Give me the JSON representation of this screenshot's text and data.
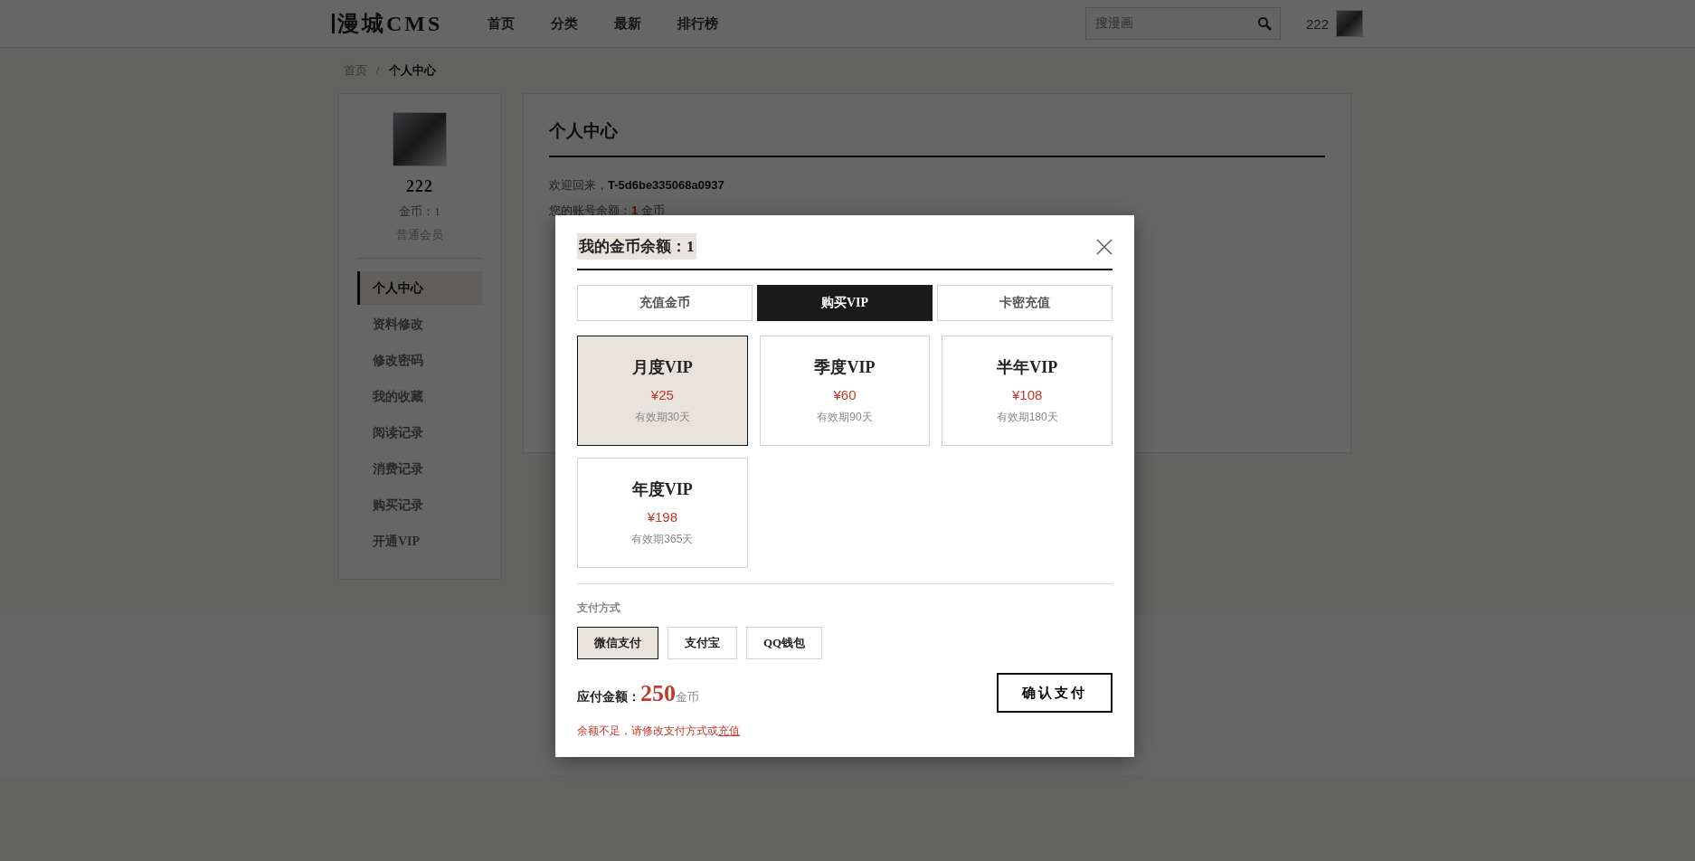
{
  "header": {
    "logo": "漫城CMS",
    "nav": [
      {
        "label": "首页"
      },
      {
        "label": "分类"
      },
      {
        "label": "最新"
      },
      {
        "label": "排行榜"
      }
    ],
    "search": {
      "placeholder": "搜漫画"
    },
    "username": "222"
  },
  "breadcrumb": [
    {
      "label": "首页",
      "selected": false
    },
    {
      "label": "个人中心",
      "selected": true
    }
  ],
  "breadcrumb_separator": "/",
  "sidebar": {
    "username": "222",
    "coins": "金币：1",
    "member_level": "普通会员",
    "items": [
      {
        "label": "个人中心",
        "selected": true
      },
      {
        "label": "资料修改",
        "selected": false
      },
      {
        "label": "修改密码",
        "selected": false
      },
      {
        "label": "我的收藏",
        "selected": false
      },
      {
        "label": "阅读记录",
        "selected": false
      },
      {
        "label": "消费记录",
        "selected": false
      },
      {
        "label": "购买记录",
        "selected": false
      },
      {
        "label": "开通VIP",
        "selected": false
      }
    ]
  },
  "content": {
    "title": "个人中心",
    "welcome": "欢迎回来，**T-5d6be335068a0937**",
    "balance_label": "您的账号余额：",
    "balance_value": "1",
    "balance_unit": "金币"
  },
  "modal": {
    "title": "我的金币余额：1",
    "tabs": [
      {
        "label": "充值金币",
        "selected": false
      },
      {
        "label": "购买VIP",
        "selected": true
      },
      {
        "label": "卡密充值",
        "selected": false
      }
    ],
    "plans": [
      {
        "name": "月度VIP",
        "price": "¥25",
        "validity": "有效期30天",
        "selected": true
      },
      {
        "name": "季度VIP",
        "price": "¥60",
        "validity": "有效期90天",
        "selected": false
      },
      {
        "name": "半年VIP",
        "price": "¥108",
        "validity": "有效期180天",
        "selected": false
      },
      {
        "name": "年度VIP",
        "price": "¥198",
        "validity": "有效期365天",
        "selected": false
      }
    ],
    "payment_label": "支付方式",
    "methods": [
      {
        "label": "微信支付",
        "selected": true
      },
      {
        "label": "支付宝",
        "selected": false
      },
      {
        "label": "QQ钱包",
        "selected": false
      }
    ],
    "amount_label": "应付金额：",
    "amount": "250",
    "amount_unit": "金币",
    "confirm": "确认支付",
    "warning": "余额不足，请修改支付方式或",
    "warning_link": "充值"
  }
}
